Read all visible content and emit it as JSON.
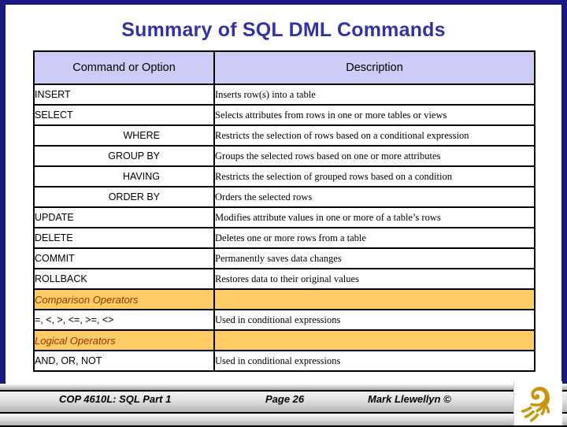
{
  "slide": {
    "title": "Summary of SQL DML Commands",
    "title_color": "#3333a0",
    "border_color": "#191980",
    "header_fill": "#ccccf7",
    "group_fill": "#ffcc66",
    "group_text_color": "#993300"
  },
  "table": {
    "headers": [
      "Command or Option",
      "Description"
    ],
    "rows": [
      {
        "command": "INSERT",
        "indent": false,
        "group": false,
        "description": "Inserts row(s) into a table"
      },
      {
        "command": "SELECT",
        "indent": false,
        "group": false,
        "description": "Selects attributes from rows in one or more tables or views"
      },
      {
        "command": "WHERE",
        "indent": true,
        "group": false,
        "description": "Restricts the selection of rows based on a conditional expression"
      },
      {
        "command": "GROUP BY",
        "indent": true,
        "group": false,
        "description": "Groups the selected rows based on one or more attributes"
      },
      {
        "command": "HAVING",
        "indent": true,
        "group": false,
        "description": "Restricts the selection of grouped rows based on a condition"
      },
      {
        "command": "ORDER BY",
        "indent": true,
        "group": false,
        "description": "Orders the selected rows"
      },
      {
        "command": "UPDATE",
        "indent": false,
        "group": false,
        "description": "Modifies attribute values in one or more of a table’s rows"
      },
      {
        "command": "DELETE",
        "indent": false,
        "group": false,
        "description": "Deletes one or more rows from a table"
      },
      {
        "command": "COMMIT",
        "indent": false,
        "group": false,
        "description": "Permanently saves data changes"
      },
      {
        "command": "ROLLBACK",
        "indent": false,
        "group": false,
        "description": "Restores data to their original values"
      },
      {
        "command": "Comparison Operators",
        "indent": false,
        "group": true,
        "description": ""
      },
      {
        "command": "=, <, >, <=, >=, <>",
        "indent": false,
        "group": false,
        "description": "Used in conditional expressions"
      },
      {
        "command": "Logical Operators",
        "indent": false,
        "group": true,
        "description": ""
      },
      {
        "command": "AND, OR, NOT",
        "indent": false,
        "group": false,
        "description": "Used in conditional expressions"
      }
    ]
  },
  "footer": {
    "course": "COP 4610L: SQL Part 1",
    "page": "Page 26",
    "author": "Mark Llewellyn ©",
    "logo": "pegasus-logo",
    "logo_color": "#c8960c"
  }
}
